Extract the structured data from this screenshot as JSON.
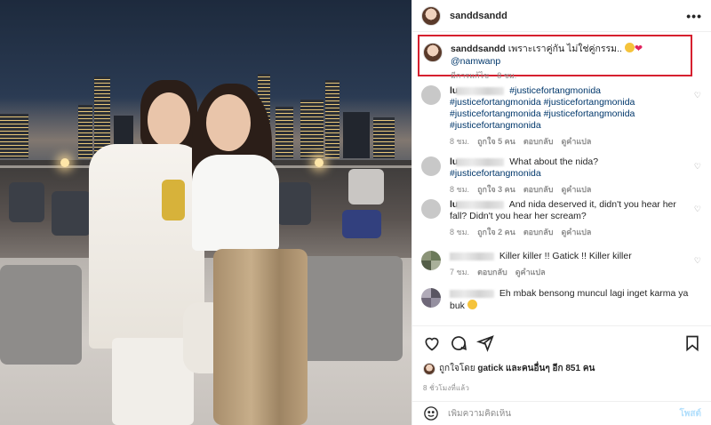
{
  "post": {
    "username": "sanddsandd",
    "more_icon": "more-horizontal-icon"
  },
  "caption": {
    "username": "sanddsandd",
    "text": "เพราะเราคู่กัน ไม่ใช่คู่กรรม..",
    "mention": "@namwanp",
    "meta_edited": "มีการแก้ไข",
    "meta_time": "8 ชม."
  },
  "comments": [
    {
      "username_prefix": "lu",
      "text": "",
      "hashtags": "#justicefortangmonida #justicefortangmonida #justicefortangmonida #justicefortangmonida #justicefortangmonida #justicefortangmonida",
      "time": "8 ชม.",
      "likes": "ถูกใจ 5 คน",
      "reply": "ตอบกลับ",
      "translate": "ดูคำแปล"
    },
    {
      "username_prefix": "lu",
      "text": "What about the nida?",
      "hashtags": "#justicefortangmonida",
      "time": "8 ชม.",
      "likes": "ถูกใจ 3 คน",
      "reply": "ตอบกลับ",
      "translate": "ดูคำแปล"
    },
    {
      "username_prefix": "lu",
      "text": "And nida deserved it, didn't you hear her fall? Didn't you hear her scream?",
      "hashtags": "",
      "time": "8 ชม.",
      "likes": "ถูกใจ 2 คน",
      "reply": "ตอบกลับ",
      "translate": "ดูคำแปล"
    },
    {
      "username_prefix": "",
      "text": "Killer killer !! Gatick !! Killer killer",
      "hashtags": "",
      "time": "7 ชม.",
      "likes": "",
      "reply": "ตอบกลับ",
      "translate": "ดูคำแปล"
    },
    {
      "username_prefix": "",
      "text": "Eh mbak bensong muncul lagi inget karma ya buk",
      "hashtags": "",
      "time": "",
      "likes": "",
      "reply": "",
      "translate": ""
    }
  ],
  "actions": {
    "like_icon": "heart-icon",
    "comment_icon": "comment-icon",
    "share_icon": "send-icon",
    "save_icon": "bookmark-icon"
  },
  "likes": {
    "prefix": "ถูกใจโดย",
    "user": "gatick",
    "middle": "และคนอื่นๆ อีก",
    "count": "851 คน"
  },
  "timestamp": "8 ชั่วโมงที่แล้ว",
  "add_comment": {
    "emoji_icon": "smiley-icon",
    "placeholder": "เพิ่มความคิดเห็น",
    "post_label": "โพสต์"
  },
  "colors": {
    "highlight_border": "#d6202f",
    "link": "#00376b",
    "muted": "#8e8e8e",
    "post_disabled": "#b2dffc"
  }
}
